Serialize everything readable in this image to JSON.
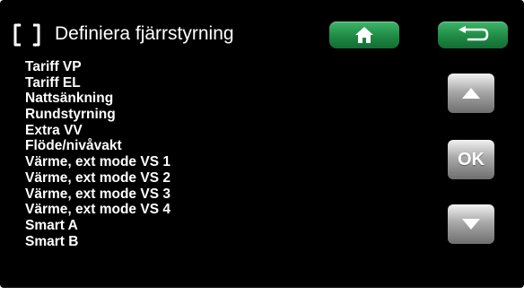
{
  "screen": {
    "title": "Definiera fjärrstyrning",
    "title_icon": "remote-control-icon"
  },
  "buttons": {
    "home_icon": "home-icon",
    "back_icon": "back-arrow-icon",
    "up_icon": "arrow-up-icon",
    "ok_label": "OK",
    "down_icon": "arrow-down-icon"
  },
  "menu": {
    "items": [
      "Tariff VP",
      "Tariff EL",
      "Nattsänkning",
      "Rundstyrning",
      "Extra VV",
      "Flöde/nivåvakt",
      "Värme, ext mode VS 1",
      "Värme, ext mode VS 2",
      "Värme, ext mode VS 3",
      "Värme, ext mode VS 4",
      "Smart A",
      "Smart B"
    ]
  },
  "colors": {
    "background": "#000000",
    "text": "#ffffff",
    "green_button": "#1f8a45",
    "gray_button": "#a9a9a9"
  }
}
